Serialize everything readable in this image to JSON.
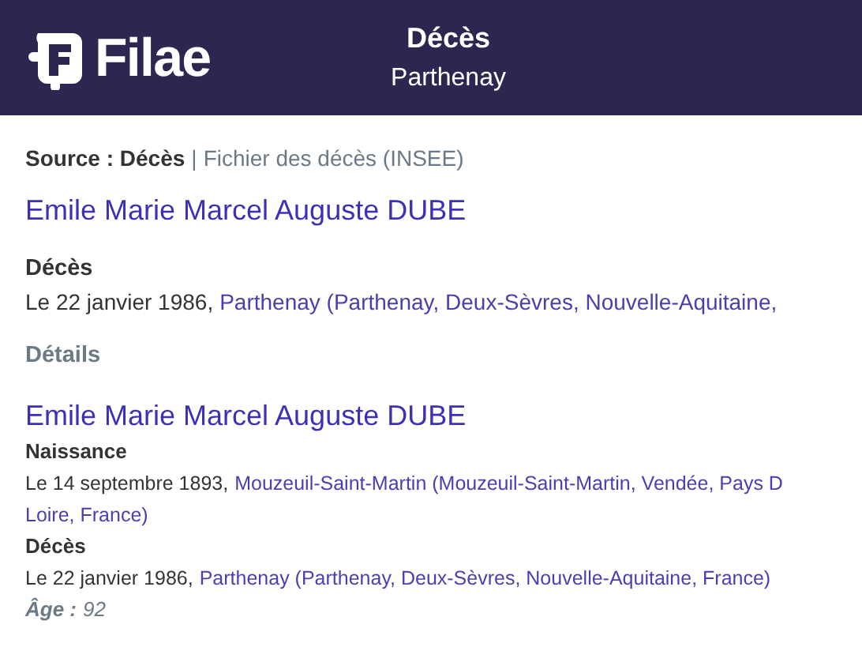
{
  "header": {
    "logo_text": "Filae",
    "title": "Décès",
    "subtitle": "Parthenay"
  },
  "source": {
    "label": "Source : Décès",
    "separator": "|",
    "detail": "Fichier des décès (INSEE)"
  },
  "records": [
    {
      "name": "Emile Marie Marcel Auguste DUBE",
      "compact": false,
      "events": [
        {
          "label": "Décès",
          "date": "Le 22 janvier 1986,",
          "place": "Parthenay (Parthenay, Deux-Sèvres, Nouvelle-Aquitaine,"
        }
      ],
      "details": "Détails"
    },
    {
      "name": "Emile Marie Marcel Auguste DUBE",
      "compact": true,
      "events": [
        {
          "label": "Naissance",
          "date": "Le 14 septembre 1893,",
          "place": "Mouzeuil-Saint-Martin (Mouzeuil-Saint-Martin, Vendée, Pays D",
          "place_continued": "Loire, France)"
        },
        {
          "label": "Décès",
          "date": "Le 22 janvier 1986,",
          "place": "Parthenay (Parthenay, Deux-Sèvres, Nouvelle-Aquitaine, France)"
        }
      ],
      "age_label": "Âge :",
      "age": "92"
    }
  ]
}
